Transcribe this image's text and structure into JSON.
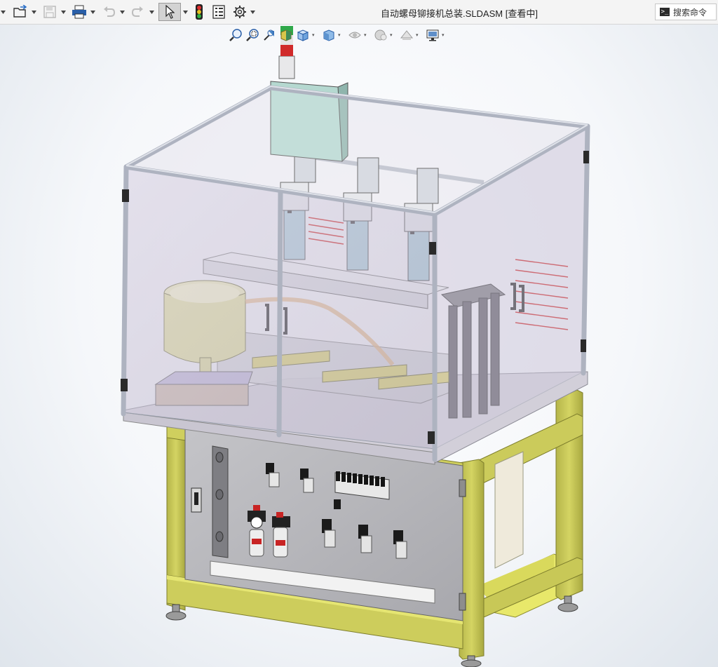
{
  "title_bar": {
    "document_title": "自动螺母铆接机总装.SLDASM [查看中]",
    "search_placeholder": "搜索命令",
    "buttons": [
      {
        "name": "open-icon"
      },
      {
        "name": "save-icon"
      },
      {
        "name": "print-icon"
      },
      {
        "name": "undo-icon"
      },
      {
        "name": "redo-icon"
      },
      {
        "name": "select-icon"
      },
      {
        "name": "traffic-light-icon"
      },
      {
        "name": "file-properties-icon"
      },
      {
        "name": "options-gear-icon"
      }
    ]
  },
  "view_toolbar": {
    "buttons": [
      {
        "name": "zoom-to-fit-icon"
      },
      {
        "name": "zoom-to-area-icon"
      },
      {
        "name": "previous-view-icon"
      },
      {
        "name": "section-view-icon"
      },
      {
        "name": "view-orientation-icon"
      },
      {
        "name": "display-style-icon"
      },
      {
        "name": "hide-show-items-icon"
      },
      {
        "name": "edit-appearance-icon"
      },
      {
        "name": "apply-scene-icon"
      },
      {
        "name": "view-settings-icon"
      }
    ]
  },
  "colors": {
    "frame_yellow": "#c9c957",
    "frame_yellow_dark": "#a3a33e",
    "glass": "#c9c3d6",
    "aluminum": "#cdd0da",
    "panel_gray": "#b4b4b8",
    "control_box": "#b5d8d0",
    "bowl": "#e6e4a6",
    "accent_red": "#cc2222"
  }
}
